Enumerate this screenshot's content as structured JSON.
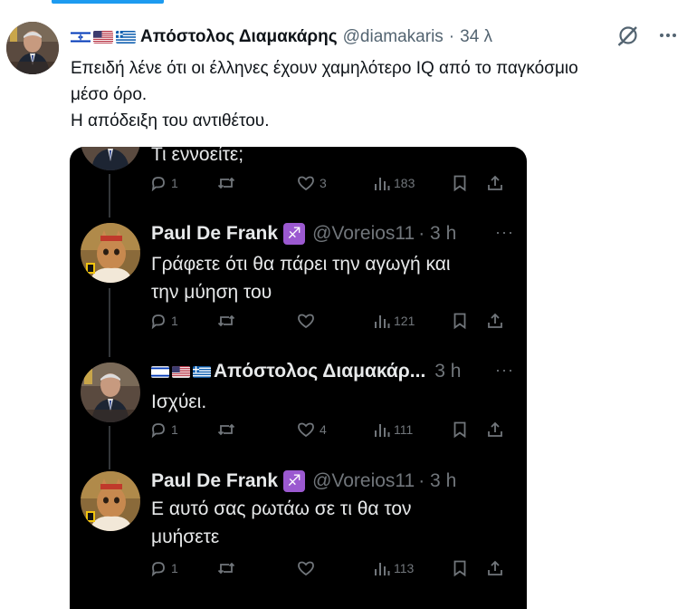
{
  "tweet": {
    "author_name": "Απόστολος Διαμακάρης",
    "handle": "@diamakaris",
    "separator": "·",
    "time": "34 λ",
    "text_lines": [
      "Επειδή λένε ότι οι έλληνες έχουν χαμηλότερο IQ από το παγκόσμιο",
      "μέσο όρο.",
      "Η απόδειξη του αντιθέτου."
    ]
  },
  "embedded": {
    "top_partial_text": "Τι εννοείτε;",
    "top_actions": {
      "replies": "1",
      "likes": "3",
      "views": "183"
    },
    "replies": [
      {
        "name": "Paul De Frank",
        "zodiac": "♐",
        "handle": "@Voreios11",
        "time": "· 3 h",
        "lines": [
          "Γράφετε ότι θα πάρει την αγωγή και",
          "την μύηση του"
        ],
        "replies": "1",
        "likes": "",
        "views": "121"
      },
      {
        "name": "Απόστολος Διαμακάρ...",
        "zodiac": "",
        "handle": "",
        "time": "3 h",
        "lines": [
          "Ισχύει."
        ],
        "replies": "1",
        "likes": "4",
        "views": "111"
      },
      {
        "name": "Paul De Frank",
        "zodiac": "♐",
        "handle": "@Voreios11",
        "time": "· 3 h",
        "lines": [
          "Ε αυτό σας ρωτάω σε τι θα τον",
          "μυήσετε"
        ],
        "replies": "1",
        "likes": "",
        "views": "113"
      }
    ]
  },
  "colors": {
    "accent": "#1d9bf0",
    "zodiac_bg": "#9b59d0",
    "dark_bg": "#000000",
    "muted": "#71767b"
  },
  "icons": [
    "grok-icon",
    "more-icon",
    "reply-icon",
    "retweet-icon",
    "like-icon",
    "views-icon",
    "bookmark-icon",
    "share-icon"
  ]
}
